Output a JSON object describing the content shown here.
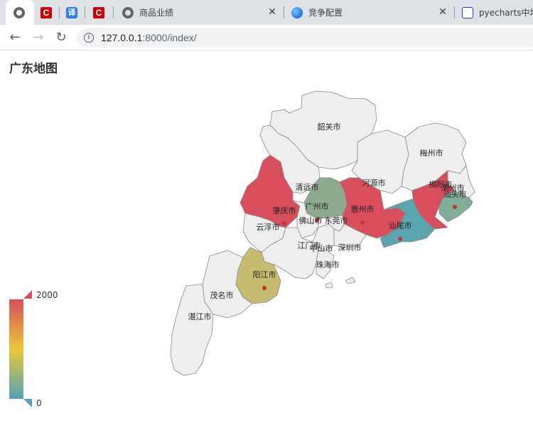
{
  "browser": {
    "tabs": [
      {
        "title": "",
        "icon": "globe-icon",
        "active": true
      },
      {
        "title": "",
        "icon": "c-logo-icon"
      },
      {
        "title": "",
        "icon": "translate-icon",
        "glyph": "译"
      },
      {
        "title": "",
        "icon": "c-logo-icon"
      },
      {
        "title": "商品业绩",
        "icon": "globe-icon"
      },
      {
        "title": "竞争配置",
        "icon": "earth-icon"
      },
      {
        "title": "pyecharts中地",
        "icon": "baidu-paw-icon"
      }
    ],
    "close_glyph": "✕",
    "url_host": "127.0.0.1",
    "url_rest": ":8000/index/"
  },
  "page": {
    "title": "广东地图"
  },
  "chart_data": {
    "type": "map",
    "title": "广东地图",
    "visual_map": {
      "min": 0,
      "max": 2000,
      "colors": [
        "#50a3ba",
        "#eac736",
        "#d94e5d"
      ]
    },
    "regions": [
      {
        "name": "韶关市",
        "color": "#eeeeee"
      },
      {
        "name": "梅州市",
        "color": "#eeeeee"
      },
      {
        "name": "清远市",
        "color": "#eeeeee"
      },
      {
        "name": "河源市",
        "color": "#eeeeee"
      },
      {
        "name": "揭阳市",
        "color": "#d94e5d"
      },
      {
        "name": "潮州市",
        "color": "#eeeeee"
      },
      {
        "name": "汕头市",
        "color": "#7fae99"
      },
      {
        "name": "肇庆市",
        "color": "#d94e5d"
      },
      {
        "name": "广州市",
        "color": "#8daa8e"
      },
      {
        "name": "惠州市",
        "color": "#d94e5d"
      },
      {
        "name": "汕尾市",
        "color": "#5aa6b0"
      },
      {
        "name": "佛山市",
        "color": "#eeeeee"
      },
      {
        "name": "东莞市",
        "color": "#eeeeee"
      },
      {
        "name": "云浮市",
        "color": "#eeeeee"
      },
      {
        "name": "江门市",
        "color": "#eeeeee"
      },
      {
        "name": "中山市",
        "color": "#eeeeee"
      },
      {
        "name": "深圳市",
        "color": "#eeeeee"
      },
      {
        "name": "珠海市",
        "color": "#eeeeee"
      },
      {
        "name": "阳江市",
        "color": "#c8bb72"
      },
      {
        "name": "茂名市",
        "color": "#eeeeee"
      },
      {
        "name": "湛江市",
        "color": "#eeeeee"
      }
    ],
    "labels": [
      {
        "name": "韶关市"
      },
      {
        "name": "梅州市"
      },
      {
        "name": "清远市"
      },
      {
        "name": "河源市"
      },
      {
        "name": "揭阳市"
      },
      {
        "name": "潮州市"
      },
      {
        "name": "汕头市"
      },
      {
        "name": "肇庆市"
      },
      {
        "name": "广州市"
      },
      {
        "name": "惠州市"
      },
      {
        "name": "汕尾市"
      },
      {
        "name": "佛山市"
      },
      {
        "name": "东莞市"
      },
      {
        "name": "云浮市"
      },
      {
        "name": "江门市"
      },
      {
        "name": "中山市"
      },
      {
        "name": "深圳市"
      },
      {
        "name": "珠海市"
      },
      {
        "name": "阳江市"
      },
      {
        "name": "茂名市"
      },
      {
        "name": "湛江市"
      }
    ]
  }
}
